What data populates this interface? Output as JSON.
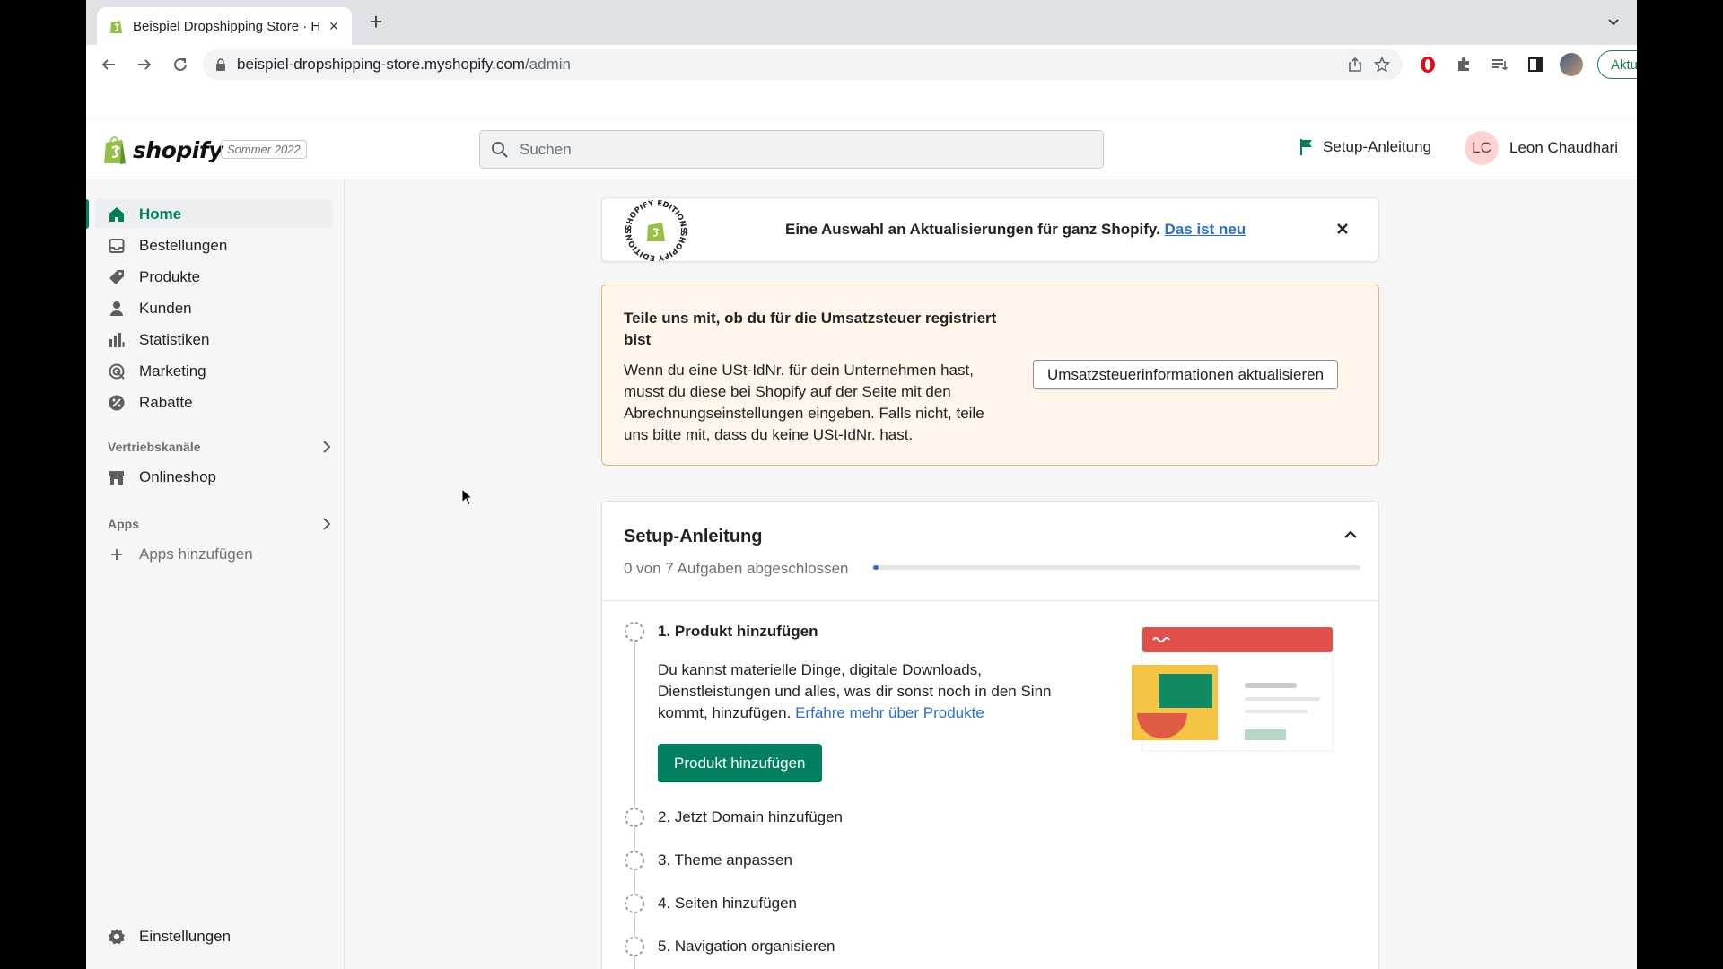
{
  "browser": {
    "tab_title": "Beispiel Dropshipping Store · H",
    "url_host": "beispiel-dropshipping-store.myshopify.com",
    "url_path": "/admin",
    "update_label": "Aktualisieren"
  },
  "topbar": {
    "brand": "shopify",
    "edition": "Sommer 2022",
    "search_placeholder": "Suchen",
    "setup_link": "Setup-Anleitung",
    "user_initials": "LC",
    "user_name": "Leon Chaudhari"
  },
  "sidebar": {
    "items": [
      {
        "label": "Home",
        "icon": "home-icon"
      },
      {
        "label": "Bestellungen",
        "icon": "inbox-icon"
      },
      {
        "label": "Produkte",
        "icon": "tag-icon"
      },
      {
        "label": "Kunden",
        "icon": "person-icon"
      },
      {
        "label": "Statistiken",
        "icon": "bar-chart-icon"
      },
      {
        "label": "Marketing",
        "icon": "target-icon"
      },
      {
        "label": "Rabatte",
        "icon": "discount-icon"
      }
    ],
    "channels_title": "Vertriebskanäle",
    "onlineshop": "Onlineshop",
    "apps_title": "Apps",
    "add_apps": "Apps hinzufügen",
    "settings": "Einstellungen"
  },
  "banner": {
    "text": "Eine Auswahl an Aktualisierungen für ganz Shopify.",
    "link": "Das ist neu",
    "badge_text": "SHOPIFY EDITIONS"
  },
  "tax": {
    "title": "Teile uns mit, ob du für die Umsatzsteuer registriert bist",
    "body": "Wenn du eine USt-IdNr. für dein Unternehmen hast, musst du diese bei Shopify auf der Seite mit den Abrechnungseinstellungen eingeben. Falls nicht, teile uns bitte mit, dass du keine USt-IdNr. hast.",
    "button": "Umsatzsteuerinformationen aktualisieren"
  },
  "setup": {
    "title": "Setup-Anleitung",
    "progress_text": "0 von 7 Aufgaben abgeschlossen",
    "progress_fraction": 0.0,
    "tasks": [
      "1. Produkt hinzufügen",
      "2. Jetzt Domain hinzufügen",
      "3. Theme anpassen",
      "4. Seiten hinzufügen",
      "5. Navigation organisieren"
    ],
    "task1_desc": "Du kannst materielle Dinge, digitale Downloads, Dienstleistungen und alles, was dir sonst noch in den Sinn kommt, hinzufügen.",
    "task1_link": "Erfahre mehr über Produkte",
    "task1_button": "Produkt hinzufügen"
  },
  "colors": {
    "accent": "#008060",
    "link": "#2c6ecb",
    "warning_bg": "#fff5ea",
    "warning_border": "#e4b27d"
  }
}
